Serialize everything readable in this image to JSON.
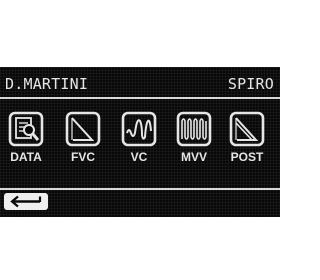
{
  "header": {
    "user_name": "D.MARTINI",
    "mode": "SPIRO"
  },
  "menu": [
    {
      "label": "DATA",
      "icon": "data-icon"
    },
    {
      "label": "FVC",
      "icon": "fvc-icon"
    },
    {
      "label": "VC",
      "icon": "vc-icon"
    },
    {
      "label": "MVV",
      "icon": "mvv-icon"
    },
    {
      "label": "POST",
      "icon": "post-icon"
    }
  ],
  "footer": {
    "back_icon": "back-arrow-icon"
  },
  "colors": {
    "screen_background": "#080808",
    "foreground": "#e6e6e6",
    "page_background": "#ffffff"
  }
}
